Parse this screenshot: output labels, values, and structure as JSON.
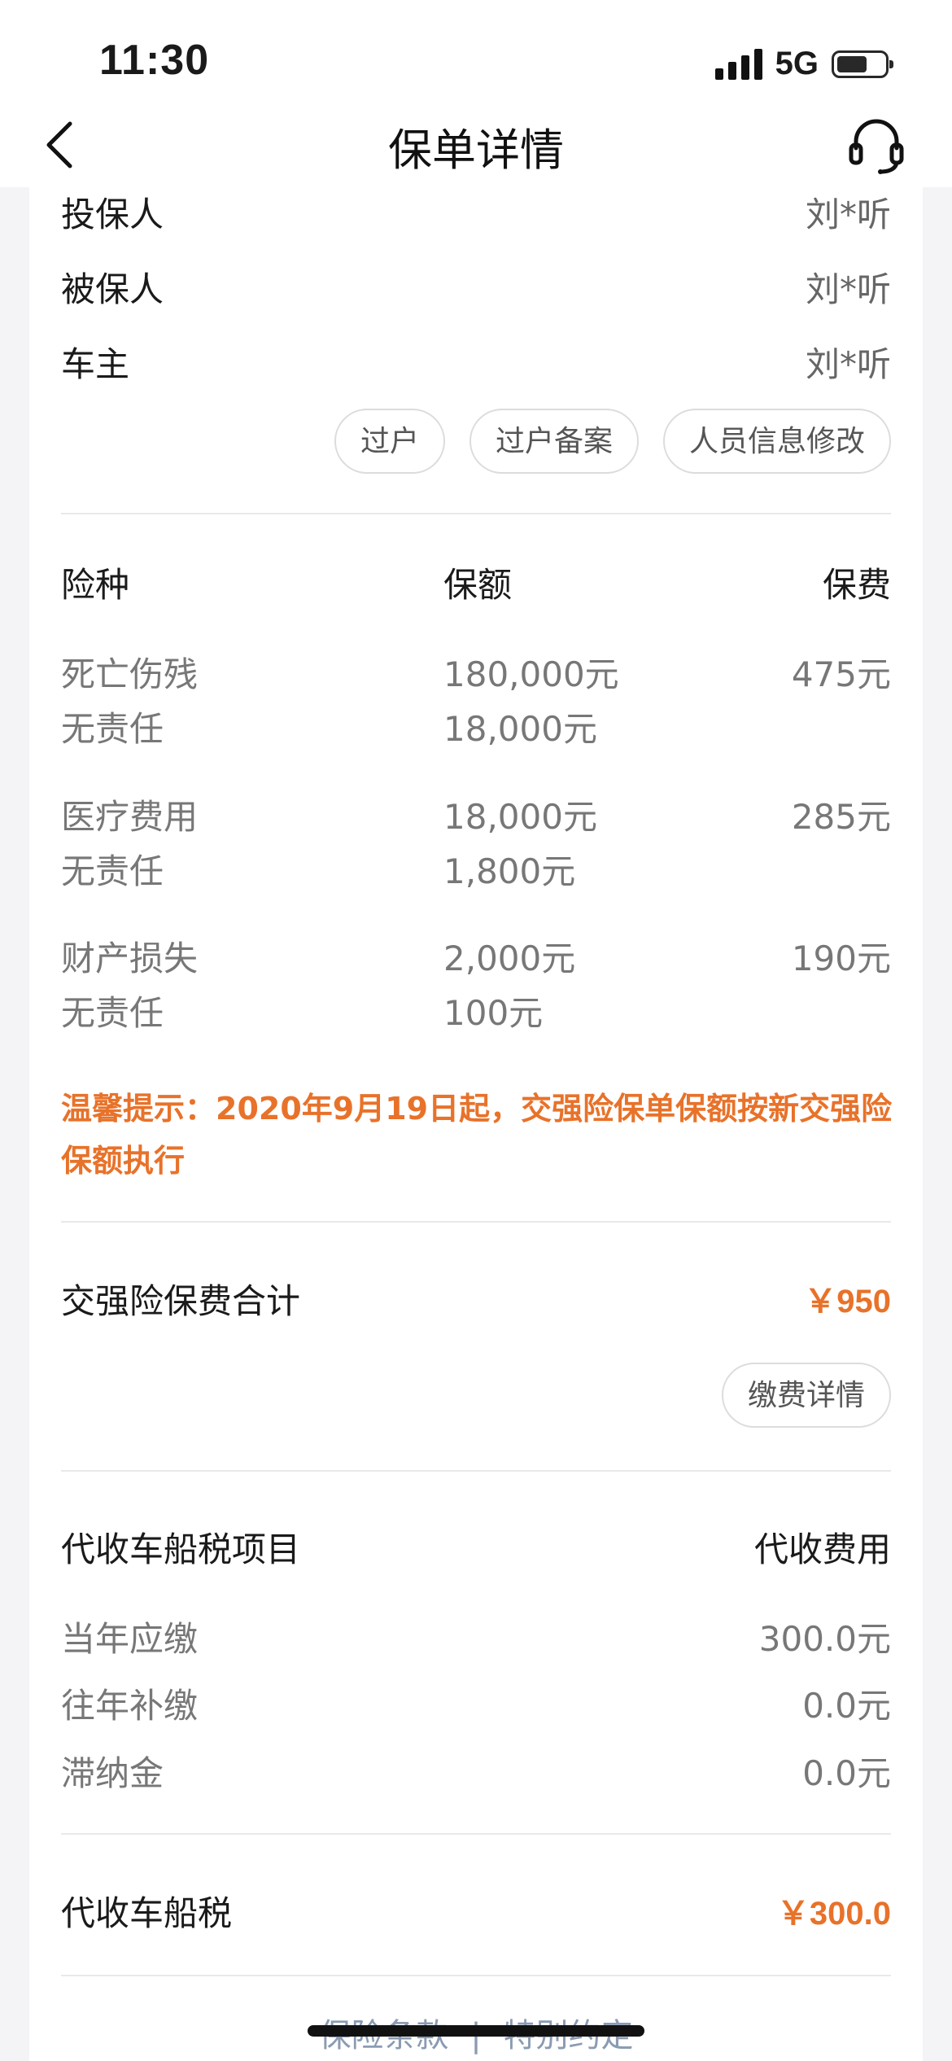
{
  "status": {
    "time": "11:30",
    "network": "5G",
    "battery_level": 0.65
  },
  "nav": {
    "title": "保单详情",
    "back_icon": "chevron-left-icon",
    "service_icon": "headset-icon"
  },
  "people": [
    {
      "label": "投保人",
      "value": "刘*听"
    },
    {
      "label": "被保人",
      "value": "刘*听"
    },
    {
      "label": "车主",
      "value": "刘*听"
    }
  ],
  "people_actions": [
    {
      "label": "过户"
    },
    {
      "label": "过户备案"
    },
    {
      "label": "人员信息修改"
    }
  ],
  "coverage": {
    "headers": {
      "type": "险种",
      "amount": "保额",
      "premium": "保费"
    },
    "items": [
      {
        "name": "死亡伤残",
        "amount": "180,000元",
        "premium": "475元",
        "sub_name": "无责任",
        "sub_amount": "18,000元"
      },
      {
        "name": "医疗费用",
        "amount": "18,000元",
        "premium": "285元",
        "sub_name": "无责任",
        "sub_amount": "1,800元"
      },
      {
        "name": "财产损失",
        "amount": "2,000元",
        "premium": "190元",
        "sub_name": "无责任",
        "sub_amount": "100元"
      }
    ]
  },
  "notice": "温馨提示：2020年9月19日起，交强险保单保额按新交强险保额执行",
  "premium_total": {
    "label": "交强险保费合计",
    "value": "￥950",
    "detail_button": "缴费详情"
  },
  "vehicle_tax": {
    "header_item": "代收车船税项目",
    "header_fee": "代收费用",
    "items": [
      {
        "label": "当年应缴",
        "value": "300.0元"
      },
      {
        "label": "往年补缴",
        "value": "0.0元"
      },
      {
        "label": "滞纳金",
        "value": "0.0元"
      }
    ],
    "total_label": "代收车船税",
    "total_value": "￥300.0"
  },
  "footer": {
    "link1": "保险条款",
    "separator": "|",
    "link2": "特别约定"
  },
  "colors": {
    "accent": "#e8722a",
    "link": "#8a9bb3"
  }
}
